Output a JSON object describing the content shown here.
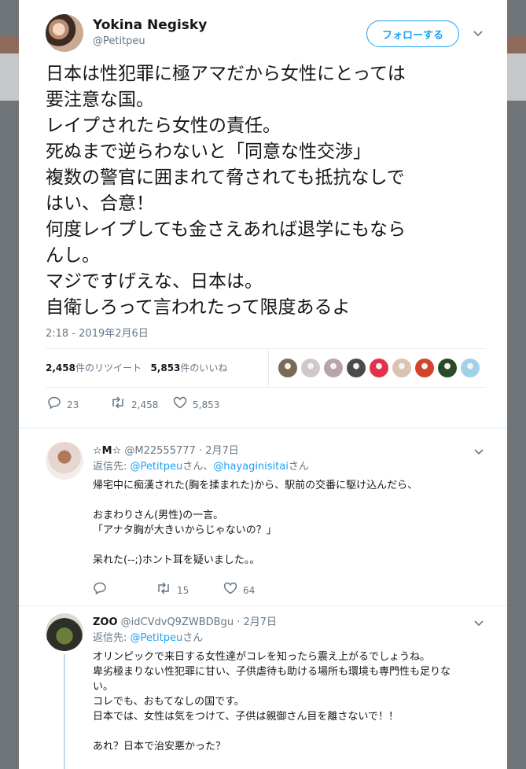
{
  "tweet": {
    "author_name": "Yokina Negisky",
    "author_handle": "@Petitpeu",
    "follow_label": "フォローする",
    "text": "日本は性犯罪に極アマだから女性にとっては\n要注意な国。\nレイプされたら女性の責任。\n死ぬまで逆らわないと「同意な性交渉」\n複数の警官に囲まれて脅されても抵抗なしで\nはい、合意！\n何度レイプしても金さえあれば退学にもなら\nんし。\nマジですげえな、日本は。\n自衛しろって言われたって限度あるよ",
    "timestamp": "2:18 - 2019年2月6日",
    "retweets_count": "2,458",
    "retweets_label": "件のリツイート",
    "likes_count": "5,853",
    "likes_label": "件のいいね",
    "reply_count": "23",
    "retweet_action_count": "2,458",
    "like_action_count": "5,853",
    "liker_colors": [
      "#7a6a55",
      "#cfc8c8",
      "#b9a5a8",
      "#4b4b4b",
      "#e23248",
      "#d8c4b0",
      "#d2452a",
      "#2a4a2a",
      "#9fd2e8"
    ]
  },
  "replies": [
    {
      "name": "☆M☆",
      "handle": "@M22555777",
      "date": "2月7日",
      "to_prefix": "返信先: ",
      "to_user1": "@Petitpeu",
      "to_san1": "さん、",
      "to_user2": "@hayaginisitai",
      "to_san2": "さん",
      "text": "帰宅中に痴漢された(胸を揉まれた)から、駅前の交番に駆け込んだら、\n\nおまわりさん(男性)の一言。\n「アナタ胸が大きいからじゃないの？」\n\n呆れた(--;)ホント耳を疑いました。。",
      "reply_count": "",
      "retweet_count": "15",
      "like_count": "64"
    },
    {
      "name": "ZOO",
      "handle": "@idCVdvQ9ZWBDBgu",
      "date": "2月7日",
      "to_prefix": "返信先: ",
      "to_user1": "@Petitpeu",
      "to_san1": "さん",
      "text": "オリンピックで来日する女性達がコレを知ったら震え上がるでしょうね。\n卑劣極まりない性犯罪に甘い、子供虐待も助ける場所も環境も専門性も足りな\nい。\nコレでも、おもてなしの国です。\n日本では、女性は気をつけて、子供は親御さん目を離さないで！！\n\nあれ？日本で治安悪かった？"
    }
  ],
  "icons": {
    "reply": "reply-icon",
    "retweet": "retweet-icon",
    "like": "heart-icon",
    "caret": "chevron-down-icon"
  },
  "colors": {
    "accent": "#1da1f2",
    "muted": "#657786"
  }
}
